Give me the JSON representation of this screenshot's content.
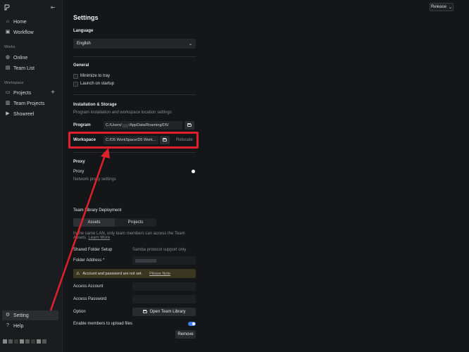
{
  "sidebar": {
    "items": {
      "home": "Home",
      "workflow": "Workflow",
      "online": "Online",
      "team_list": "Team List",
      "projects": "Projects",
      "team_projects": "Team Projects",
      "showreel": "Showreel",
      "setting": "Setting",
      "help": "Help"
    },
    "sections": {
      "works": "Works",
      "workspace": "Workspace"
    },
    "plus": "+"
  },
  "header": {
    "release": "Release"
  },
  "settings": {
    "title": "Settings",
    "language": {
      "label": "Language",
      "value": "English"
    },
    "general": {
      "label": "General",
      "minimize": "Minimize to tray",
      "launch": "Launch on startup"
    },
    "install": {
      "label": "Installation & Storage",
      "desc": "Program installation and workspace location settings",
      "program_label": "Program",
      "program_path_a": "C:/Users/",
      "program_path_b": "/AppData/Roaming/D5/",
      "workspace_label": "Workspace",
      "workspace_path": "C:/D5 WorkSpace/D5 Work...",
      "relocate": "Relocate"
    },
    "proxy": {
      "label": "Proxy",
      "item": "Proxy",
      "desc": "Network proxy settings"
    },
    "team": {
      "label": "Team Library Deployment",
      "tab_assets": "Assets",
      "tab_projects": "Projects",
      "desc_line1": "In the same LAN, only team members can access the Team",
      "desc_line2": "Assets.",
      "learn_more": "Learn More",
      "shared_label": "Shared Folder Setup",
      "shared_value": "Samba protocol support only",
      "folder_label": "Folder Address",
      "required": "*",
      "warn_text": "Account and password are not set.",
      "warn_link": "Please Note",
      "account_label": "Access Account",
      "password_label": "Access Password",
      "option_label": "Option",
      "open_lib": "Open Team Library",
      "upload_label": "Enable members to upload files",
      "remove": "Remove"
    }
  },
  "colors": {
    "highlight": "#e0202c",
    "toggle_on": "#3d7ff0",
    "warning_bg": "#3a3620"
  }
}
